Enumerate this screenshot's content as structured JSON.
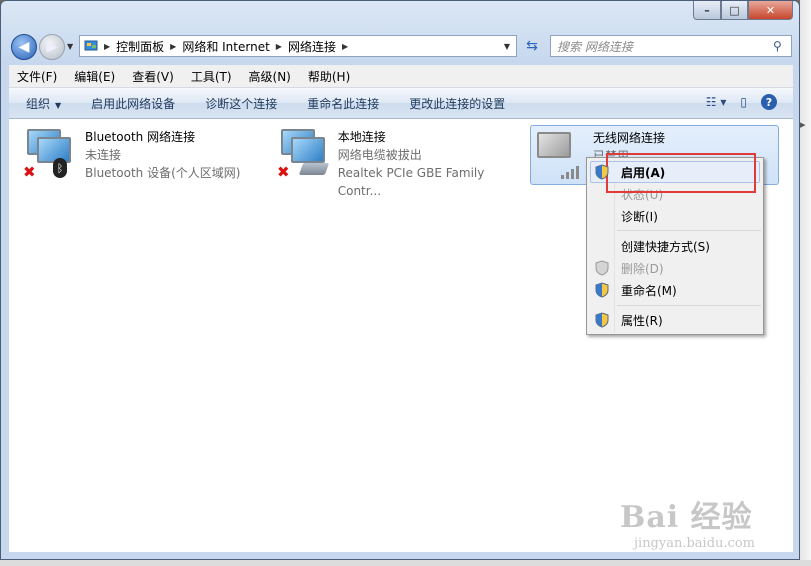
{
  "window": {
    "caption": {
      "minimize": "–",
      "maximize": "□",
      "close": "✕"
    }
  },
  "address": {
    "crumbs": [
      "控制面板",
      "网络和 Internet",
      "网络连接"
    ],
    "search_placeholder": "搜索 网络连接"
  },
  "menubar": [
    "文件(F)",
    "编辑(E)",
    "查看(V)",
    "工具(T)",
    "高级(N)",
    "帮助(H)"
  ],
  "commands": {
    "organize": "组织",
    "enable_device": "启用此网络设备",
    "diagnose": "诊断这个连接",
    "rename": "重命名此连接",
    "change_settings": "更改此连接的设置"
  },
  "connections": [
    {
      "name": "Bluetooth 网络连接",
      "status": "未连接",
      "device": "Bluetooth 设备(个人区域网)"
    },
    {
      "name": "本地连接",
      "status": "网络电缆被拔出",
      "device": "Realtek PCIe GBE Family Contr..."
    },
    {
      "name": "无线网络连接",
      "status": "已禁用",
      "device": "..."
    }
  ],
  "context_menu": {
    "enable": "启用(A)",
    "status": "状态(U)",
    "diagnose": "诊断(I)",
    "create_shortcut": "创建快捷方式(S)",
    "delete": "删除(D)",
    "rename": "重命名(M)",
    "properties": "属性(R)"
  },
  "watermark": {
    "main": "Bai 经验",
    "sub": "jingyan.baidu.com"
  },
  "colors": {
    "highlight_box": "#e03a3a",
    "accent": "#2a63b8"
  }
}
